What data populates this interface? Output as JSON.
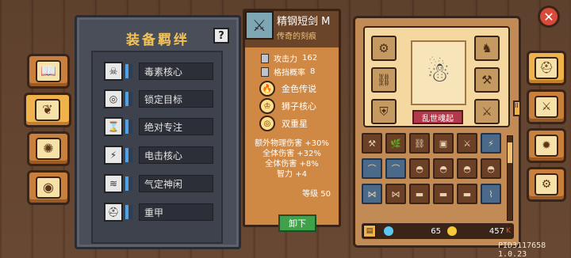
{
  "left_tabs": [
    {
      "icon": "book-icon",
      "glyph": "📖"
    },
    {
      "icon": "chest-icon",
      "glyph": "❦"
    },
    {
      "icon": "gear-coins-icon",
      "glyph": "✺"
    },
    {
      "icon": "shield-icon",
      "glyph": "◉"
    }
  ],
  "bonus_panel": {
    "title": "装备羁绊",
    "help": "?",
    "rows": [
      {
        "label": "毒素核心",
        "icon": "skull-icon",
        "glyph": "☠",
        "filled": 1
      },
      {
        "label": "锁定目标",
        "icon": "target-icon",
        "glyph": "◎",
        "filled": 1
      },
      {
        "label": "绝对专注",
        "icon": "hourglass-icon",
        "glyph": "⌛",
        "filled": 1
      },
      {
        "label": "电击核心",
        "icon": "lightning-icon",
        "glyph": "⚡",
        "filled": 1
      },
      {
        "label": "气定神闲",
        "icon": "steam-icon",
        "glyph": "≋",
        "filled": 1
      },
      {
        "label": "重甲",
        "icon": "helmet-icon",
        "glyph": "⛑",
        "filled": 1
      }
    ]
  },
  "item": {
    "name": "精钢短剑 M",
    "subtitle": "传奇的刻痕",
    "stats": [
      {
        "label": "攻击力",
        "value": "162"
      },
      {
        "label": "格挡概率",
        "value": "8"
      }
    ],
    "traits": [
      {
        "label": "金色传说",
        "glyph": "🔥"
      },
      {
        "label": "狮子核心",
        "glyph": "♔"
      },
      {
        "label": "双重星",
        "glyph": "◎"
      }
    ],
    "bonuses": [
      "额外物理伤害 +30%",
      "全体伤害 +32%",
      "全体伤害 +8%",
      "智力 +4"
    ],
    "level": "等级 50",
    "unequip": "卸下"
  },
  "character": {
    "name": "乱世魂起",
    "slots": [
      "⚙",
      "⛓",
      "⛨",
      "♞",
      "⚒",
      "⚔"
    ],
    "slot_badge": "+4",
    "side_tag": "II"
  },
  "inventory": {
    "items": [
      "⚒",
      "🌿",
      "⛓",
      "▣",
      "⚔",
      "⚡",
      "⌒",
      "⌒",
      "◓",
      "◓",
      "◓",
      "◓",
      "⋈",
      "⋈",
      "▬",
      "▬",
      "▬",
      "⌇"
    ],
    "gems": "65",
    "coins": "457",
    "coins_suffix": "K"
  },
  "right_tabs": [
    {
      "icon": "helmet-icon",
      "glyph": "⛑"
    },
    {
      "icon": "swords-icon",
      "glyph": "⚔"
    },
    {
      "icon": "gear-icon",
      "glyph": "✹"
    },
    {
      "icon": "settings-icon",
      "glyph": "⚙"
    }
  ],
  "close": "✕",
  "version": "PID3117658 1.0.23"
}
